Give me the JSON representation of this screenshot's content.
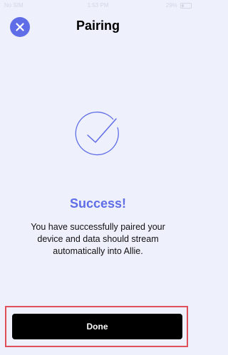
{
  "status_bar": {
    "carrier": "No SIM",
    "time": "1:53 PM",
    "battery": "29%"
  },
  "header": {
    "title": "Pairing",
    "close_icon": "close-icon"
  },
  "content": {
    "icon": "checkmark-circle-icon",
    "heading": "Success!",
    "message": "You have successfully paired your device and data should stream automatically into Allie."
  },
  "footer": {
    "done_label": "Done"
  },
  "colors": {
    "accent": "#5f6de6",
    "background": "#eef0fc",
    "button": "#000000",
    "highlight": "#e0505a"
  }
}
